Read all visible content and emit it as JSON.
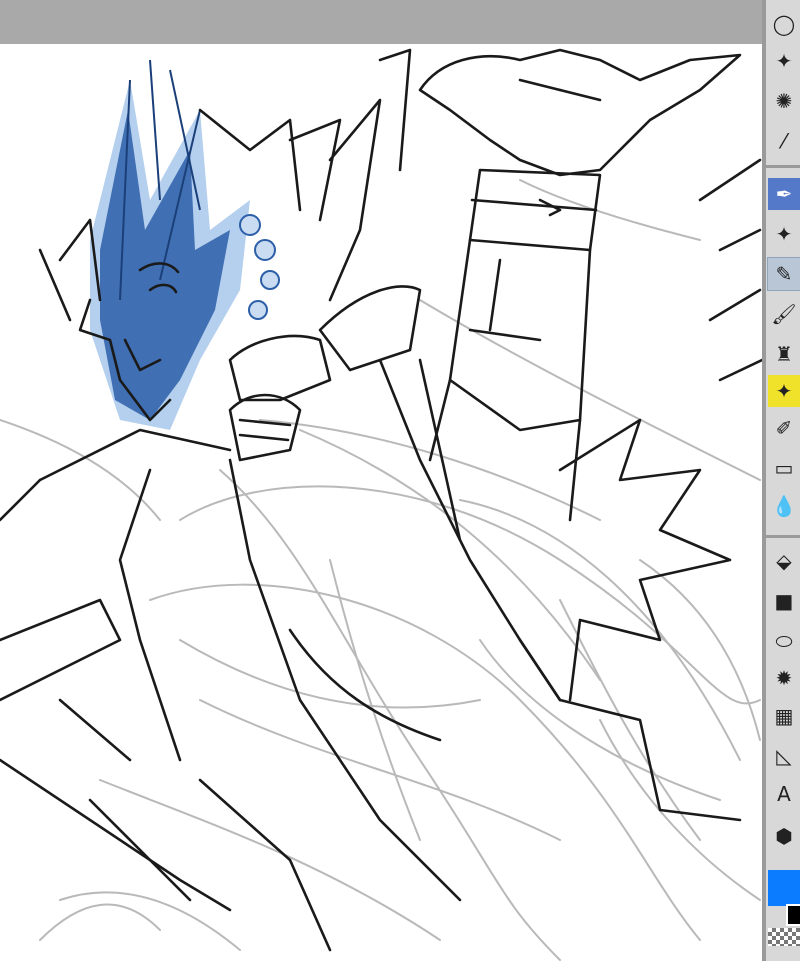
{
  "window": {
    "topbar_color": "#a9a9a9",
    "panel_color": "#d8d8d8",
    "divider_color": "#9a9a9a"
  },
  "canvas": {
    "background": "#ffffff",
    "line_color": "#1a1a1a",
    "rough_sketch_color": "#b9b9b9",
    "blue_color": "#2c5fa8",
    "light_blue_color": "#9cc0e8"
  },
  "tools": [
    {
      "name": "lasso-icon",
      "glyph": "◯",
      "selected": false
    },
    {
      "name": "magic-wand-icon",
      "glyph": "✦",
      "selected": false
    },
    {
      "name": "sparkle-select-icon",
      "glyph": "✺",
      "selected": false
    },
    {
      "name": "eyedropper-icon",
      "glyph": "⁄",
      "selected": false
    },
    {
      "name": "pen-icon",
      "glyph": "✒",
      "selected": "blue"
    },
    {
      "name": "star-brush-icon",
      "glyph": "✦",
      "selected": false
    },
    {
      "name": "pencil-icon",
      "glyph": "✎",
      "selected": "gray"
    },
    {
      "name": "brush-icon",
      "glyph": "🖌",
      "selected": false
    },
    {
      "name": "airbrush-icon",
      "glyph": "♜",
      "selected": false
    },
    {
      "name": "decoration-icon",
      "glyph": "✦",
      "selected": "yellow"
    },
    {
      "name": "marker-icon",
      "glyph": "✐",
      "selected": false
    },
    {
      "name": "eraser-icon",
      "glyph": "▭",
      "selected": false
    },
    {
      "name": "blend-icon",
      "glyph": "💧",
      "selected": false
    },
    {
      "name": "fill-icon",
      "glyph": "⬙",
      "selected": false
    },
    {
      "name": "gradient-icon",
      "glyph": "■",
      "selected": false
    },
    {
      "name": "ellipse-icon",
      "glyph": "⬭",
      "selected": false
    },
    {
      "name": "burst-icon",
      "glyph": "✹",
      "selected": false
    },
    {
      "name": "frame-icon",
      "glyph": "▦",
      "selected": false
    },
    {
      "name": "ruler-icon",
      "glyph": "◺",
      "selected": false
    },
    {
      "name": "text-icon",
      "glyph": "A",
      "selected": false
    },
    {
      "name": "balloon-icon",
      "glyph": "⬢",
      "selected": false
    }
  ],
  "colors": {
    "foreground": "#0b7bff",
    "background": "#000000"
  }
}
